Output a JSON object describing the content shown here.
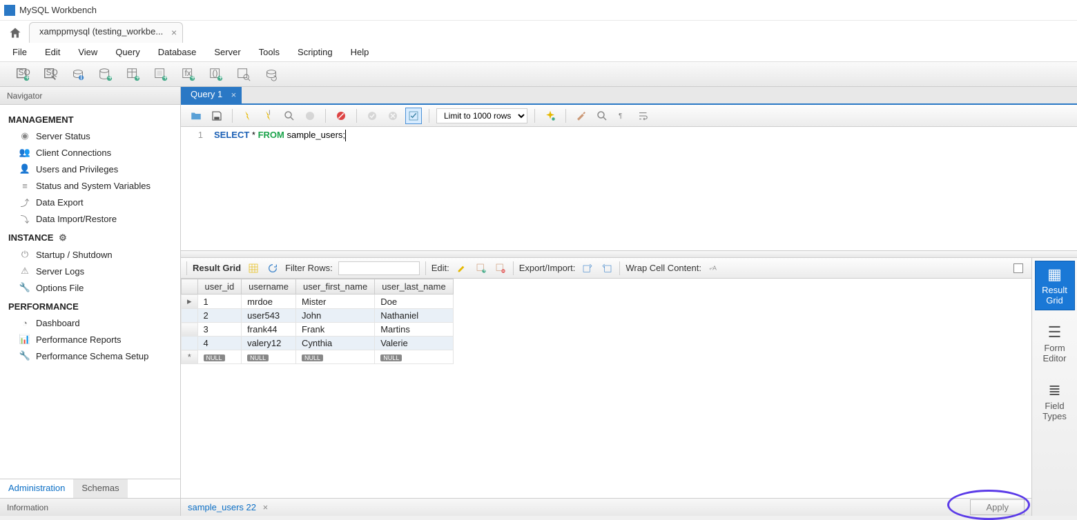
{
  "app": {
    "title": "MySQL Workbench"
  },
  "connection_tab": "xamppmysql  (testing_workbe...",
  "menubar": [
    "File",
    "Edit",
    "View",
    "Query",
    "Database",
    "Server",
    "Tools",
    "Scripting",
    "Help"
  ],
  "navigator": {
    "title": "Navigator",
    "sections": {
      "management": {
        "label": "MANAGEMENT",
        "items": [
          "Server Status",
          "Client Connections",
          "Users and Privileges",
          "Status and System Variables",
          "Data Export",
          "Data Import/Restore"
        ]
      },
      "instance": {
        "label": "INSTANCE",
        "items": [
          "Startup / Shutdown",
          "Server Logs",
          "Options File"
        ]
      },
      "performance": {
        "label": "PERFORMANCE",
        "items": [
          "Dashboard",
          "Performance Reports",
          "Performance Schema Setup"
        ]
      }
    },
    "bottom_tabs": {
      "active": "Administration",
      "inactive": "Schemas"
    },
    "info_label": "Information"
  },
  "query_tab": {
    "label": "Query 1"
  },
  "editor_toolbar": {
    "limit_rows": "Limit to 1000 rows"
  },
  "code": {
    "line_number": "1",
    "kw_select": "SELECT",
    "star": " * ",
    "kw_from": "FROM",
    "rest": " sample_users;"
  },
  "result_toolbar": {
    "result_grid": "Result Grid",
    "filter_label": "Filter Rows:",
    "edit_label": "Edit:",
    "export_label": "Export/Import:",
    "wrap_label": "Wrap Cell Content:"
  },
  "result_columns": [
    "user_id",
    "username",
    "user_first_name",
    "user_last_name"
  ],
  "result_rows": [
    {
      "user_id": "1",
      "username": "mrdoe",
      "first": "Mister",
      "last": "Doe"
    },
    {
      "user_id": "2",
      "username": "user543",
      "first": "John",
      "last": "Nathaniel"
    },
    {
      "user_id": "3",
      "username": "frank44",
      "first": "Frank",
      "last": "Martins"
    },
    {
      "user_id": "4",
      "username": "valery12",
      "first": "Cynthia",
      "last": "Valerie"
    }
  ],
  "null_label": "NULL",
  "side_panel": {
    "result_grid": "Result\nGrid",
    "form_editor": "Form\nEditor",
    "field_types": "Field\nTypes"
  },
  "result_tab": "sample_users 22",
  "apply_label": "Apply"
}
